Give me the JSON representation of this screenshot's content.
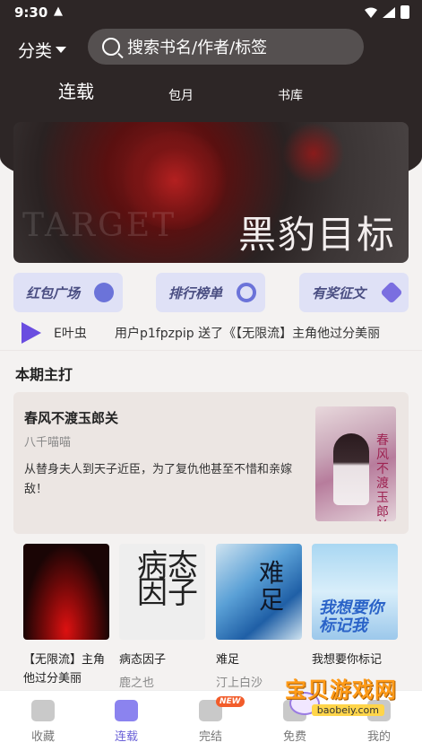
{
  "status": {
    "time": "9:30",
    "alert_glyph": "▲"
  },
  "header": {
    "category_label": "分类",
    "search_placeholder": "搜索书名/作者/标签"
  },
  "tabs": [
    {
      "label": "连载",
      "active": true
    },
    {
      "label": "包月",
      "active": false
    },
    {
      "label": "书库",
      "active": false
    }
  ],
  "banner": {
    "title": "黑豹目标",
    "faint_text": "TARGET"
  },
  "chips": [
    {
      "label": "红包广场",
      "icon": "eye-icon"
    },
    {
      "label": "排行榜单",
      "icon": "medal-icon"
    },
    {
      "label": "有奖征文",
      "icon": "triangle-icon"
    }
  ],
  "ticker": {
    "left": "E叶虫",
    "message": "用户p1fpzpip 送了《【无限流】主角他过分美丽"
  },
  "section": {
    "title": "本期主打"
  },
  "featured": {
    "title": "春风不渡玉郎关",
    "author": "八千喵喵",
    "description": "从替身夫人到天子近臣，为了复仇他甚至不惜和亲嫁敌！",
    "cover_text": "春风不渡玉郎关"
  },
  "books": [
    {
      "title": "【无限流】主角他过分美丽",
      "author": "",
      "cover_text": ""
    },
    {
      "title": "病态因子",
      "author": "鹿之也",
      "cover_text": "病态因子"
    },
    {
      "title": "难足",
      "author": "汀上白沙",
      "cover_text": "难足"
    },
    {
      "title": "我想要你标记",
      "author": "",
      "cover_text": "我想要你标记我"
    }
  ],
  "bottom_nav": [
    {
      "label": "收藏",
      "active": false
    },
    {
      "label": "连载",
      "active": true
    },
    {
      "label": "完结",
      "active": false,
      "badge": "NEW"
    },
    {
      "label": "免费",
      "active": false
    },
    {
      "label": "我的",
      "active": false
    }
  ],
  "watermark": {
    "text": "宝贝游戏网",
    "url": "baobeiy.com"
  },
  "colors": {
    "accent": "#6b62d8",
    "hero": "#2d2626",
    "chip_bg": "#dfe1f6"
  }
}
